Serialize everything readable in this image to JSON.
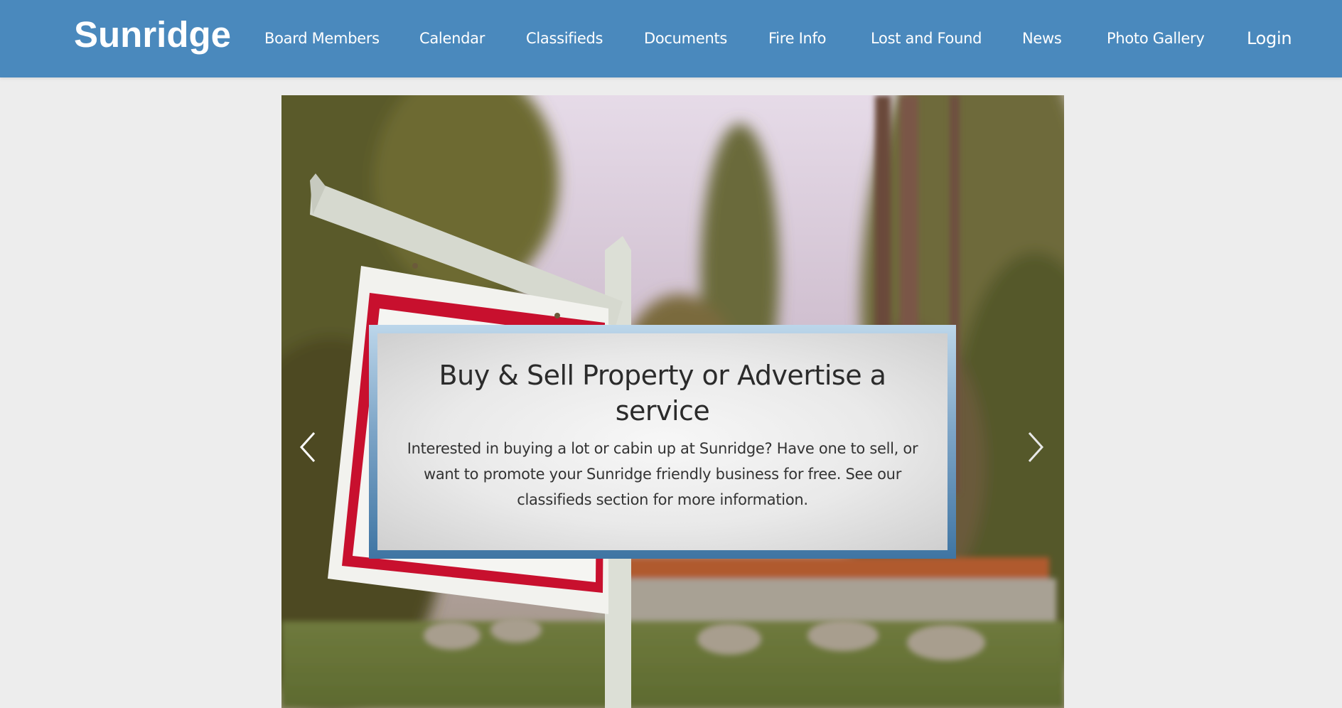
{
  "header": {
    "brand": "Sunridge",
    "nav": [
      {
        "label": "Board Members"
      },
      {
        "label": "Calendar"
      },
      {
        "label": "Classifieds"
      },
      {
        "label": "Documents"
      },
      {
        "label": "Fire Info"
      },
      {
        "label": "Lost and Found"
      },
      {
        "label": "News"
      },
      {
        "label": "Photo Gallery"
      }
    ],
    "login_label": "Login"
  },
  "carousel": {
    "slide": {
      "title": "Buy & Sell Property or Advertise a service",
      "text": "Interested in buying a lot or cabin up at Sunridge? Have one to sell, or want to promote your Sunridge friendly business for free. See our classifieds section for more information."
    },
    "prev_icon": "chevron-left-icon",
    "next_icon": "chevron-right-icon"
  },
  "colors": {
    "header_bg": "#4a89bd",
    "page_bg": "#ededed",
    "caption_border_top": "#bcd6ea",
    "caption_border_bottom": "#3f75a3"
  }
}
